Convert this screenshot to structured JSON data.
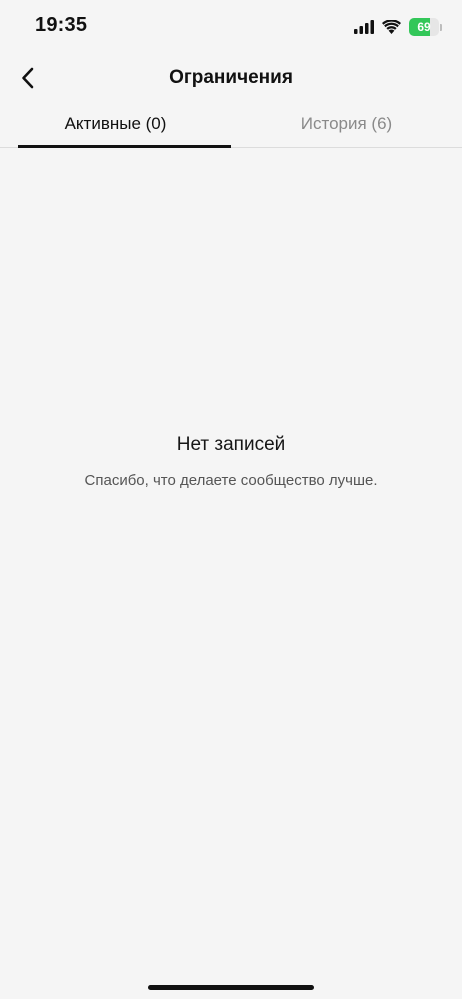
{
  "status_bar": {
    "time": "19:35",
    "battery_percent": 69,
    "battery_label": "69",
    "signal_icon": "cellular-signal-icon",
    "wifi_icon": "wifi-icon",
    "battery_icon": "battery-charging-icon",
    "battery_color": "#33c759"
  },
  "header": {
    "title": "Ограничения",
    "back_icon": "chevron-left-icon"
  },
  "tabs": [
    {
      "label": "Активные (0)",
      "active": true
    },
    {
      "label": "История (6)",
      "active": false
    }
  ],
  "empty_state": {
    "title": "Нет записей",
    "subtitle": "Спасибо, что делаете сообщество лучше."
  }
}
